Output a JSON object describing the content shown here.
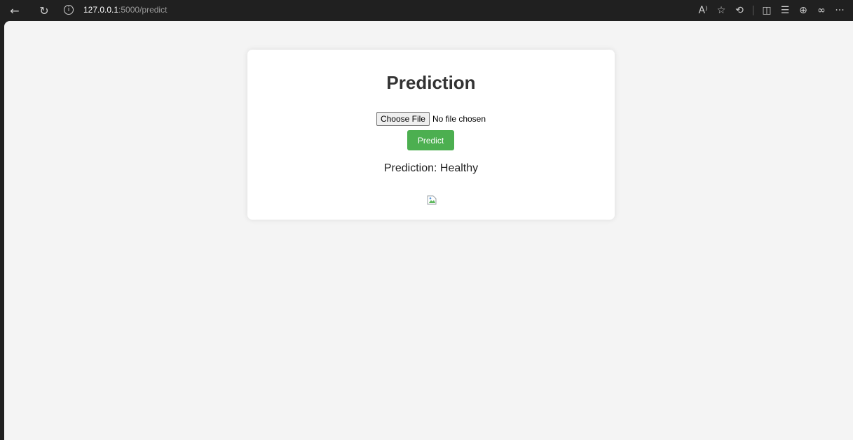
{
  "browser": {
    "url_host": "127.0.0.1",
    "url_path": ":5000/predict",
    "icons": [
      "back-icon",
      "refresh-icon",
      "info-icon",
      "read-aloud-icon",
      "favorite-icon",
      "extensions-icon",
      "split-screen-icon",
      "favorites-list-icon",
      "collections-icon",
      "copilot-icon",
      "more-icon"
    ]
  },
  "page": {
    "title": "Prediction",
    "choose_file_label": "Choose File",
    "no_file_text": "No file chosen",
    "predict_label": "Predict",
    "result_text": "Prediction: Healthy"
  },
  "colors": {
    "accent": "#4caf50",
    "page_background": "#f4f4f4",
    "card_background": "#ffffff"
  }
}
